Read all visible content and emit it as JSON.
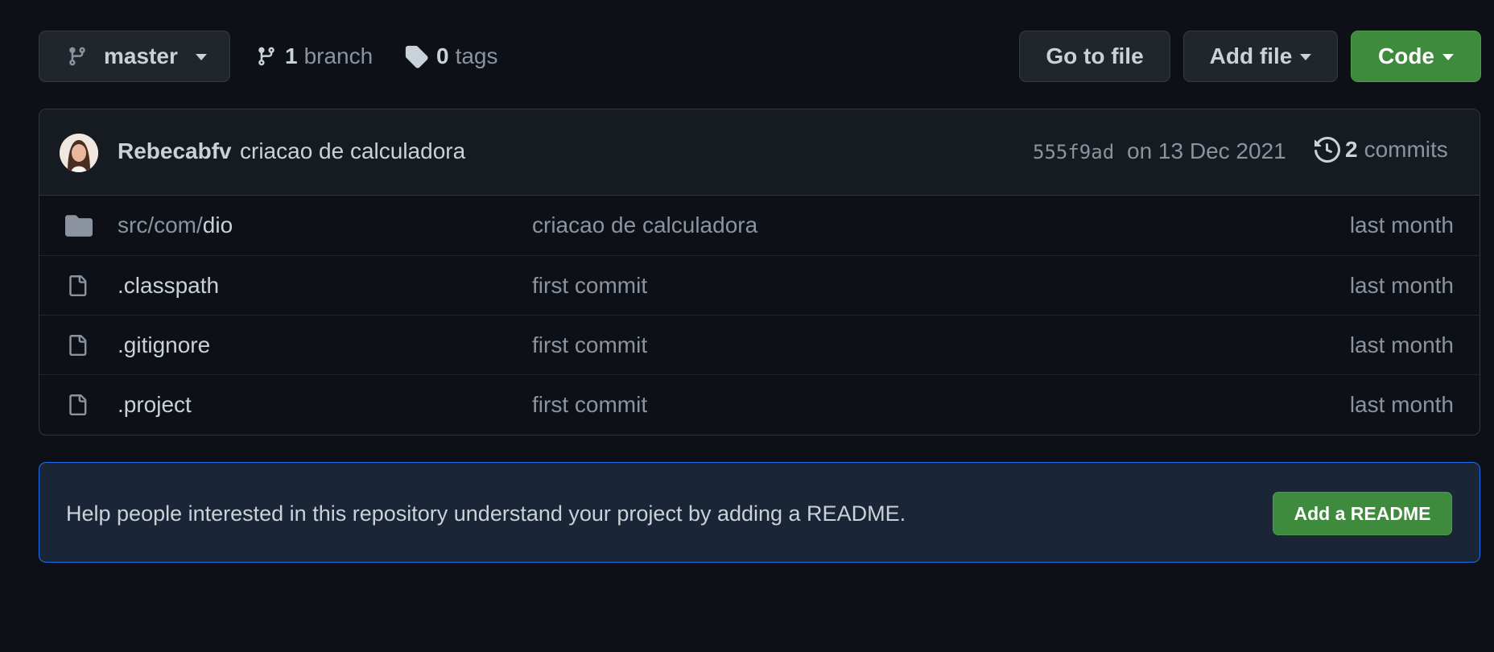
{
  "toolbar": {
    "branch_selector_label": "master",
    "branch_count": "1",
    "branch_label": "branch",
    "tag_count": "0",
    "tag_label": "tags",
    "go_to_file_label": "Go to file",
    "add_file_label": "Add file",
    "code_label": "Code"
  },
  "commit": {
    "author": "Rebecabfv",
    "message": "criacao de calculadora",
    "sha": "555f9ad",
    "date": "on 13 Dec 2021",
    "commits_count": "2",
    "commits_label": "commits"
  },
  "files": [
    {
      "type": "folder",
      "name_prefix": "src/com/",
      "name": "dio",
      "message": "criacao de calculadora",
      "age": "last month"
    },
    {
      "type": "file",
      "name_prefix": "",
      "name": ".classpath",
      "message": "first commit",
      "age": "last month"
    },
    {
      "type": "file",
      "name_prefix": "",
      "name": ".gitignore",
      "message": "first commit",
      "age": "last month"
    },
    {
      "type": "file",
      "name_prefix": "",
      "name": ".project",
      "message": "first commit",
      "age": "last month"
    }
  ],
  "readme": {
    "message": "Help people interested in this repository understand your project by adding a README.",
    "button_label": "Add a README"
  },
  "colors": {
    "background": "#0d1117",
    "primary_button": "#3f8b3d",
    "readme_border": "#1f6feb"
  }
}
